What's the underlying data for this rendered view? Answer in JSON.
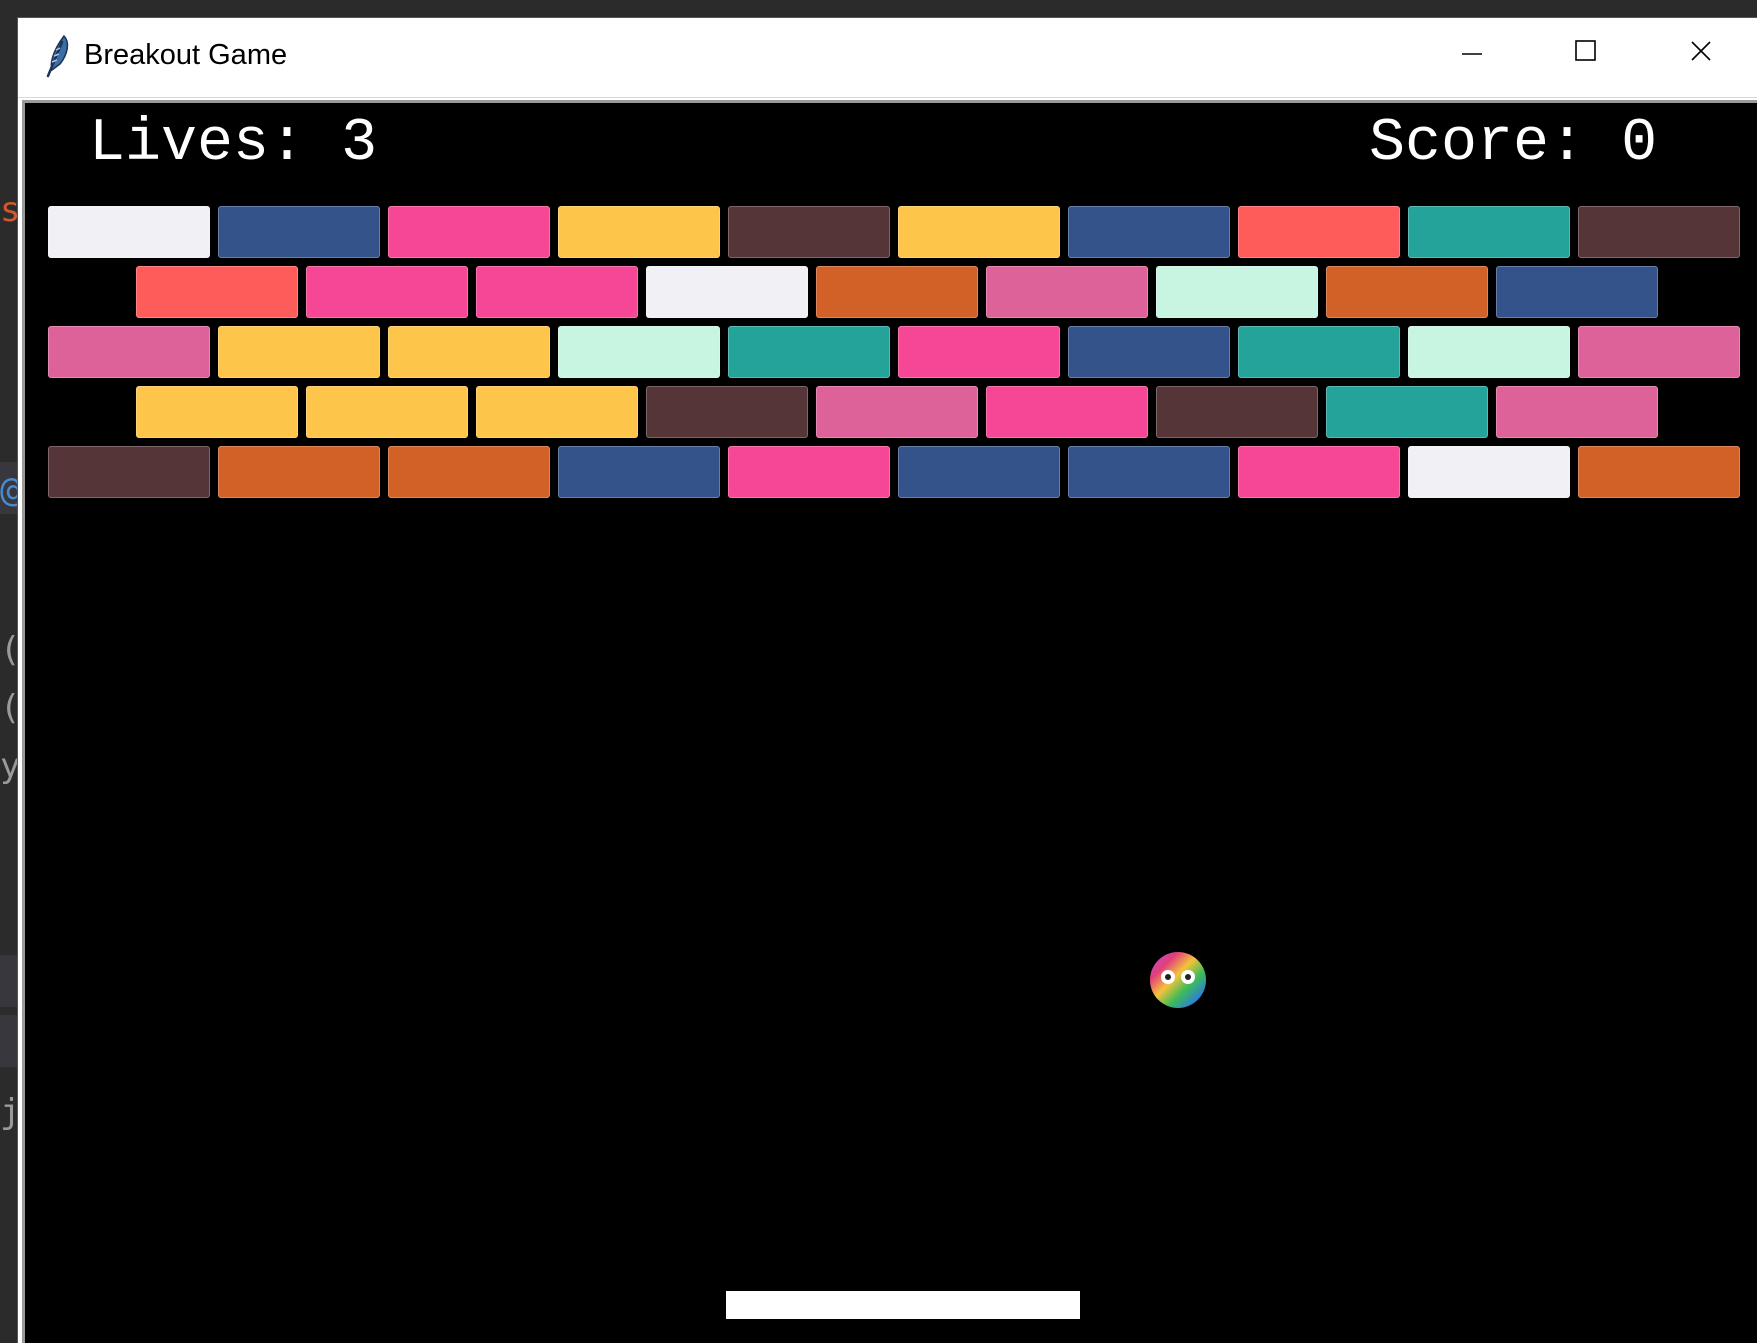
{
  "window": {
    "title": "Breakout Game",
    "icon": "feather-icon",
    "controls": [
      "minimize-icon",
      "maximize-icon",
      "close-icon"
    ]
  },
  "background_editor": {
    "glyphs": [
      "sh",
      "@",
      "()",
      "()",
      "y_",
      "j"
    ]
  },
  "hud": {
    "lives_label": "Lives:",
    "lives_value": "3",
    "score_label": "Score:",
    "score_value": "0"
  },
  "colors": {
    "canvas": "#000000",
    "paddle": "#ffffff",
    "text": "#ffffff"
  },
  "bricks": {
    "rows": [
      [
        "#f1f0f5",
        "#34538a",
        "#f54795",
        "#fec54b",
        "#553537",
        "#fec54b",
        "#34538a",
        "#fe5b5b",
        "#24a39b",
        "#553537"
      ],
      [
        "#fe5b5b",
        "#f54795",
        "#f54795",
        "#f1f0f5",
        "#d16126",
        "#dd6299",
        "#c8f5e1",
        "#d16126",
        "#34538a"
      ],
      [
        "#dd6299",
        "#fec54b",
        "#fec54b",
        "#c8f5e1",
        "#24a39b",
        "#f54795",
        "#34538a",
        "#24a39b",
        "#c8f5e1",
        "#dd6299"
      ],
      [
        "#fec54b",
        "#fec54b",
        "#fec54b",
        "#553537",
        "#dd6299",
        "#f54795",
        "#553537",
        "#24a39b",
        "#dd6299"
      ],
      [
        "#553537",
        "#d16126",
        "#d16126",
        "#34538a",
        "#f54795",
        "#34538a",
        "#34538a",
        "#f54795",
        "#f1f0f5",
        "#d16126"
      ]
    ]
  },
  "ball": {
    "icon": "rainbow-face-ball"
  }
}
